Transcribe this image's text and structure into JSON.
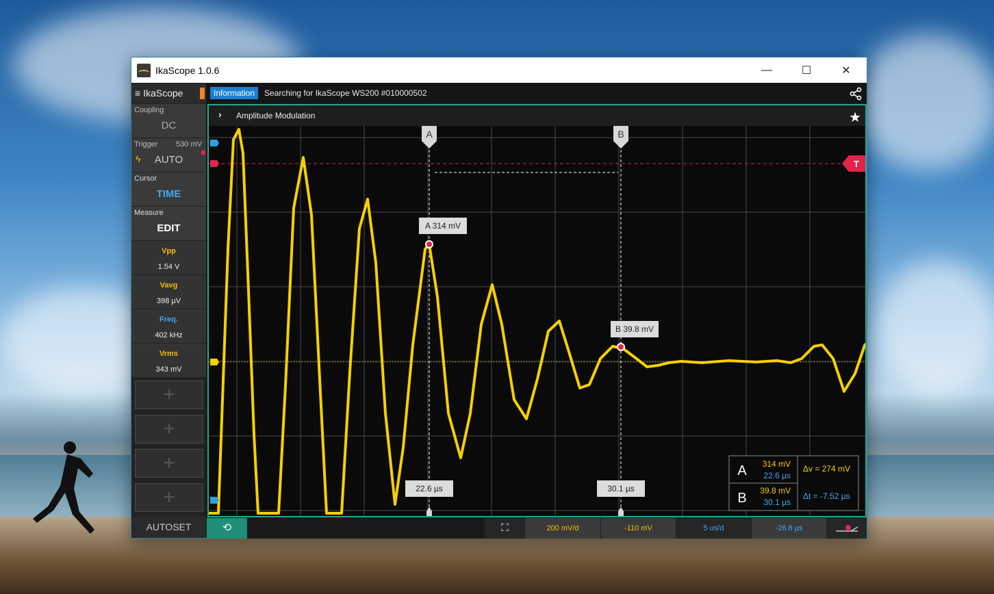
{
  "window": {
    "title": "IkaScope 1.0.6",
    "minimize": "—",
    "maximize": "☐",
    "close": "✕"
  },
  "sidebar": {
    "app_name": "IkaScope",
    "menu_icon": "hamburger-icon",
    "coupling": {
      "label": "Coupling",
      "value": "DC"
    },
    "trigger": {
      "label": "Trigger",
      "level": "530 mV",
      "value": "AUTO"
    },
    "cursor": {
      "label": "Cursor",
      "value": "TIME"
    },
    "measure": {
      "label": "Measure",
      "value": "EDIT"
    },
    "measurements": [
      {
        "name": "Vpp",
        "value": "1.54 V",
        "color": "#f0c000"
      },
      {
        "name": "Vavg",
        "value": "398 µV",
        "color": "#f0c000"
      },
      {
        "name": "Freq.",
        "value": "402 kHz",
        "color": "#3fa9f5"
      },
      {
        "name": "Vrms",
        "value": "343 mV",
        "color": "#f0c000"
      }
    ],
    "add_slot": "+",
    "autoset": "AUTOSET"
  },
  "infobar": {
    "badge": "Information",
    "message": "Searching for IkaScope WS200 #010000502"
  },
  "scope": {
    "title": "Amplitude Modulation",
    "cursor_a_flag": "A",
    "cursor_b_flag": "B",
    "trigger_flag": "T",
    "cursor_a_label": "A  314 mV",
    "cursor_b_label": "B  39.8 mV",
    "cursor_a_time": "22.6 µs",
    "cursor_b_time": "30.1 µs",
    "readout": {
      "a_name": "A",
      "a_voltage": "314 mV",
      "a_time": "22.6 µs",
      "b_name": "B",
      "b_voltage": "39.8 mV",
      "b_time": "30.1 µs",
      "delta_v": "Δv = 274 mV",
      "delta_t": "Δt = -7.52 µs"
    },
    "colors": {
      "trace": "#f5d000",
      "trigger": "#e0244a",
      "accent": "#2aa58d",
      "time_blue": "#3fa9f5"
    }
  },
  "bottombar": {
    "history_icon": "history-icon",
    "fit_icon": "fullscreen-icon",
    "volts_per_div": "200 mV/d",
    "offset": "-110 mV",
    "time_per_div": "5 us/d",
    "time_offset": "-26.8 µs",
    "probe_icon": "probe-icon"
  }
}
